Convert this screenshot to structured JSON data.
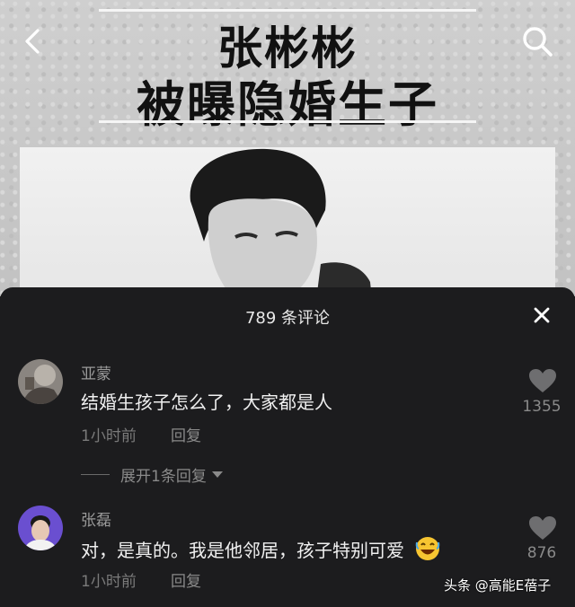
{
  "video": {
    "title_line1": "张彬彬",
    "title_line2": "被曝隐婚生子"
  },
  "panel": {
    "title": "789 条评论"
  },
  "comments": [
    {
      "username": "亚蒙",
      "text": "结婚生孩子怎么了，大家都是人",
      "time": "1小时前",
      "reply_label": "回复",
      "likes": "1355",
      "expand_label": "展开1条回复"
    },
    {
      "username": "张磊",
      "text": "对，是真的。我是他邻居，孩子特别可爱",
      "time": "1小时前",
      "reply_label": "回复",
      "likes": "876"
    }
  ],
  "watermark": "头条 @高能E蓓子",
  "colors": {
    "panel_bg": "#1c1c1e",
    "text_primary": "#f0f0f0",
    "text_secondary": "#8a8a8a"
  },
  "icons": [
    "back-arrow-icon",
    "search-icon",
    "close-icon",
    "heart-icon",
    "laughing-emoji-icon",
    "chevron-down-icon"
  ]
}
